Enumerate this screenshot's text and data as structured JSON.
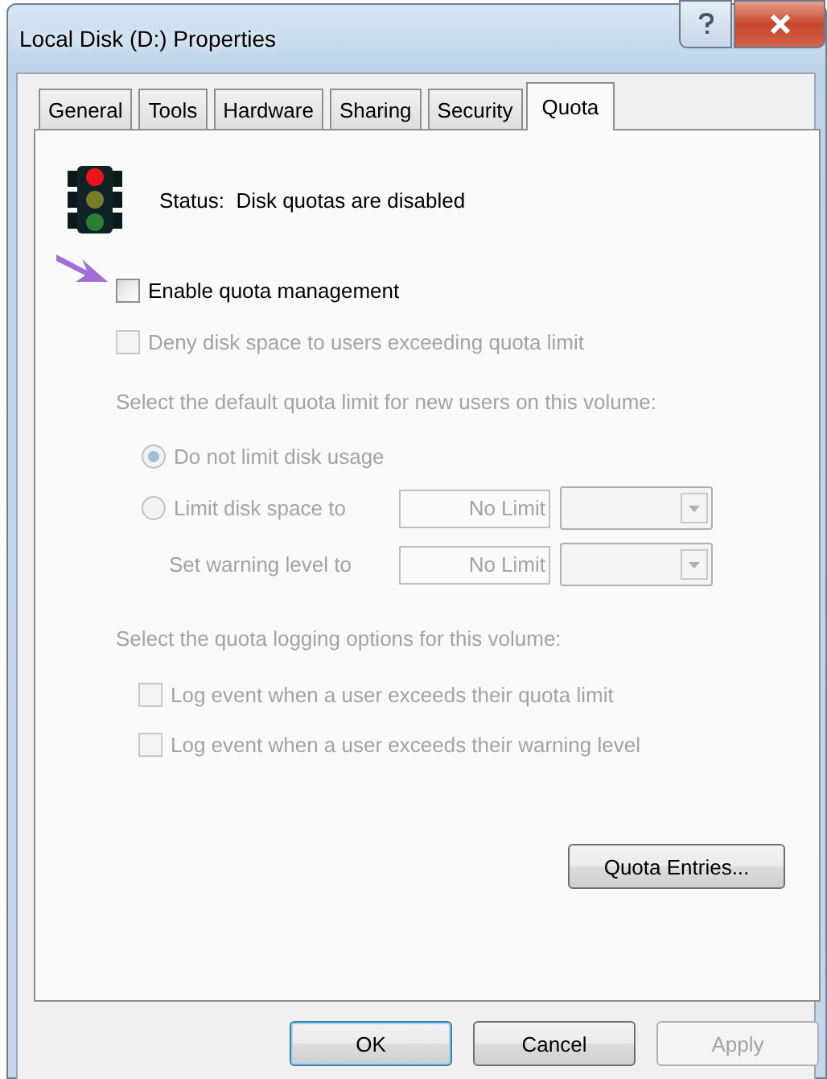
{
  "window": {
    "title": "Local Disk (D:) Properties"
  },
  "tabs": [
    {
      "label": "General",
      "selected": false
    },
    {
      "label": "Tools",
      "selected": false
    },
    {
      "label": "Hardware",
      "selected": false
    },
    {
      "label": "Sharing",
      "selected": false
    },
    {
      "label": "Security",
      "selected": false
    },
    {
      "label": "Quota",
      "selected": true
    }
  ],
  "status": "Status:  Disk quotas are disabled",
  "enable_quota": {
    "label": "Enable quota management",
    "checked": false,
    "disabled": false
  },
  "deny_space": {
    "label": "Deny disk space to users exceeding quota limit",
    "checked": false,
    "disabled": true
  },
  "default_limit": {
    "heading": "Select the default quota limit for new users on this volume:",
    "disabled": true,
    "options": [
      {
        "label": "Do not limit disk usage",
        "selected": true
      },
      {
        "label": "Limit disk space to",
        "selected": false,
        "value": "No Limit"
      }
    ],
    "warning": {
      "label": "Set warning level to",
      "value": "No Limit"
    }
  },
  "logging": {
    "heading": "Select the quota logging options for this volume:",
    "disabled": true,
    "options": [
      {
        "label": "Log event when a user exceeds their quota limit",
        "checked": false
      },
      {
        "label": "Log event when a user exceeds their warning level",
        "checked": false
      }
    ]
  },
  "quota_entries": {
    "label": "Quota Entries...",
    "disabled": false
  },
  "buttons": [
    {
      "label": "OK",
      "default": true,
      "disabled": false
    },
    {
      "label": "Cancel",
      "default": false,
      "disabled": false
    },
    {
      "label": "Apply",
      "default": false,
      "disabled": true
    }
  ]
}
